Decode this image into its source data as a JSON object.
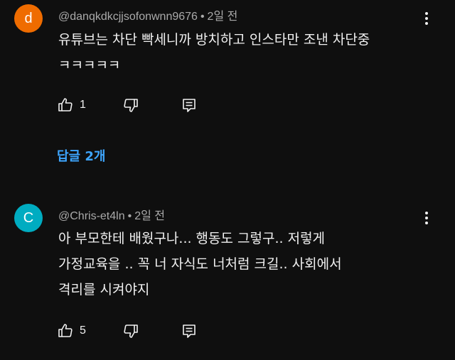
{
  "comments": [
    {
      "avatar_letter": "d",
      "avatar_color": "#ef6c00",
      "username": "@danqkdkcjjsofonwnn9676",
      "separator": "•",
      "time": "2일 전",
      "lines": [
        "유튜브는 차단 빡세니까 방치하고 인스타만 조낸 차단중",
        "ㅋㅋㅋㅋㅋ"
      ],
      "likes": "1",
      "replies_label": "답글 2개"
    },
    {
      "avatar_letter": "C",
      "avatar_color": "#00acc1",
      "username": "@Chris-et4ln",
      "separator": "•",
      "time": "2일 전",
      "lines": [
        "아 부모한테 배웠구나... 행동도 그렇구.. 저렇게",
        "가정교육을 .. 꼭 너 자식도 너처럼 크길.. 사회에서",
        "격리를 시켜야지"
      ],
      "likes": "5"
    }
  ],
  "icons": {
    "like": "thumbs-up-icon",
    "dislike": "thumbs-down-icon",
    "reply": "reply-icon",
    "more": "more-vert-icon"
  },
  "colors": {
    "background": "#0f0f0f",
    "text": "#f1f1f1",
    "meta": "#aaaaaa",
    "link": "#3ea6ff"
  }
}
